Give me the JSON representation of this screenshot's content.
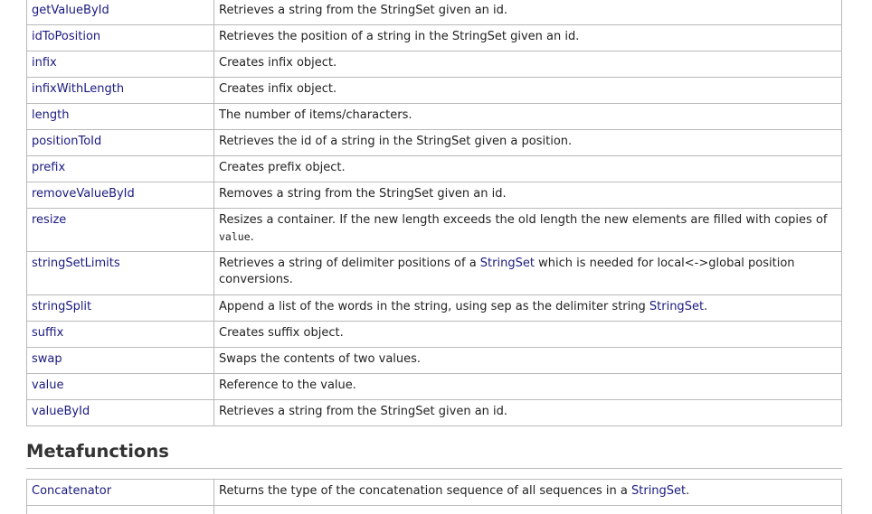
{
  "functions": [
    {
      "name": "getValueById",
      "desc": "Retrieves a string from the StringSet given an id."
    },
    {
      "name": "idToPosition",
      "desc": "Retrieves the position of a string in the StringSet given an id."
    },
    {
      "name": "infix",
      "desc": "Creates infix object."
    },
    {
      "name": "infixWithLength",
      "desc": "Creates infix object."
    },
    {
      "name": "length",
      "desc": "The number of items/characters."
    },
    {
      "name": "positionToId",
      "desc": "Retrieves the id of a string in the StringSet given a position."
    },
    {
      "name": "prefix",
      "desc": "Creates prefix object."
    },
    {
      "name": "removeValueById",
      "desc": "Removes a string from the StringSet given an id."
    },
    {
      "name": "resize",
      "desc": "Resizes a container. If the new length exceeds the old length the new elements are filled with copies of",
      "code": "value",
      "code_tail": "."
    },
    {
      "name": "stringSetLimits",
      "desc_pre": "Retrieves a string of delimiter positions of a ",
      "desc_link": "StringSet",
      "desc_post": " which is needed for local<->global position conversions."
    },
    {
      "name": "stringSplit",
      "desc_pre": "Append a list of the words in the string, using sep as the delimiter string ",
      "desc_link": "StringSet",
      "desc_post": "."
    },
    {
      "name": "suffix",
      "desc": "Creates suffix object."
    },
    {
      "name": "swap",
      "desc": "Swaps the contents of two values."
    },
    {
      "name": "value",
      "desc": "Reference to the value."
    },
    {
      "name": "valueById",
      "desc": "Retrieves a string from the StringSet given an id."
    }
  ],
  "metafunctions_heading": "Metafunctions",
  "metafunctions": [
    {
      "name": "Concatenator",
      "desc_pre": "Returns the type of the concatenation sequence of all sequences in a ",
      "desc_link": "StringSet",
      "desc_post": "."
    },
    {
      "name": "",
      "desc": ""
    }
  ]
}
